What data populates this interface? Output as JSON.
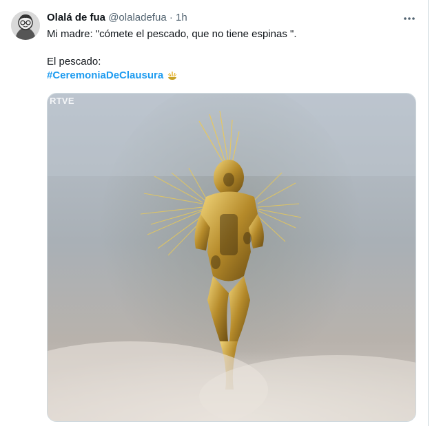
{
  "author": {
    "display_name": "Olalá de fua",
    "handle": "@olaladefua",
    "separator": "·",
    "time": "1h"
  },
  "tweet": {
    "line1": "Mi madre: \"cómete el pescado, que no tiene espinas \".",
    "line2": "El pescado:",
    "hashtag": "#CeremoniaDeClausura",
    "hashtag_emoji_icon": "torch-icon"
  },
  "media": {
    "watermark": "RTVE",
    "description_icon": "photo"
  },
  "more_icon": "more-options-icon",
  "colors": {
    "link": "#1d9bf0",
    "secondary_text": "#536471",
    "border": "#cfd9de",
    "gold": "#c9a227"
  }
}
